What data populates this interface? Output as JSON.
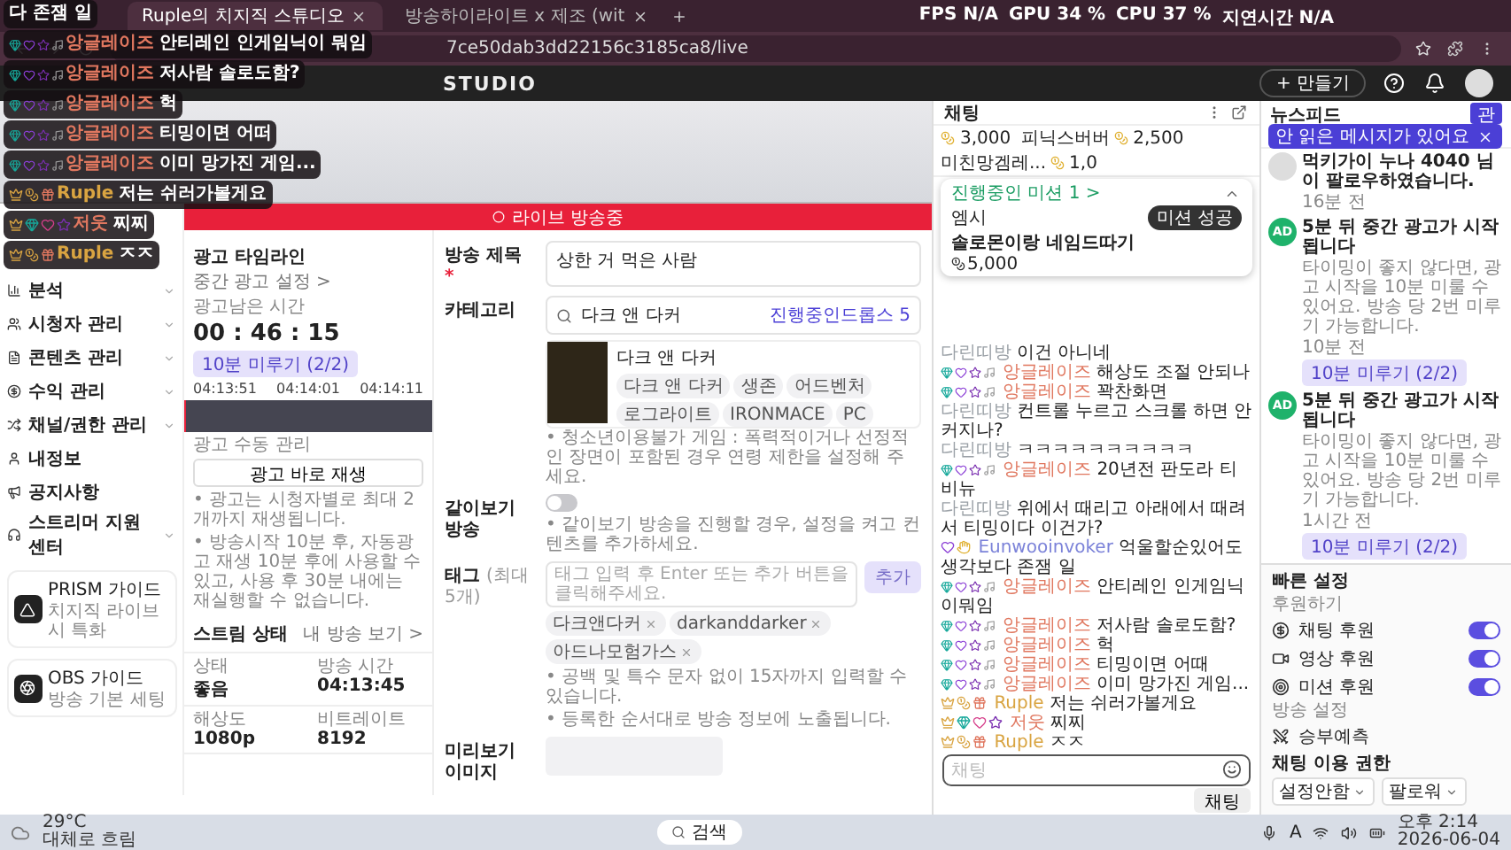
{
  "browser": {
    "tabs": [
      {
        "title": "Ruple의 치지직 스튜디오",
        "selected": true
      },
      {
        "title": "방송하이라이트 x 제조 (wit",
        "selected": false
      }
    ],
    "address": "7ce50dab3dd22156c3185ca8/live"
  },
  "stats": [
    {
      "label": "FPS",
      "value": "N/A"
    },
    {
      "label": "GPU",
      "value": "34 %"
    },
    {
      "label": "CPU",
      "value": "37 %"
    },
    {
      "label": "지연시간",
      "value": "N/A"
    }
  ],
  "studio_header": {
    "logo": "STUDIO",
    "create_button": "+ 만들기"
  },
  "overlay_chat": [
    {
      "kind": "text",
      "message": "다 존잼 일"
    },
    {
      "kind": "subscriber",
      "name": "앙글레이즈",
      "color": "#e0775f",
      "message": "안티레인 인게임닉이 뭐임"
    },
    {
      "kind": "subscriber",
      "name": "앙글레이즈",
      "color": "#e0775f",
      "message": "저사람 솔로도함?"
    },
    {
      "kind": "subscriber",
      "name": "앙글레이즈",
      "color": "#e0775f",
      "message": "헉"
    },
    {
      "kind": "subscriber",
      "name": "앙글레이즈",
      "color": "#e0775f",
      "message": "티밍이면 어떠"
    },
    {
      "kind": "subscriber",
      "name": "앙글레이즈",
      "color": "#e0775f",
      "message": "이미 망가진 게임..."
    },
    {
      "kind": "streamer",
      "name": "Ruple",
      "color": "#d9a441",
      "message": "저는 쉬러가볼게요"
    },
    {
      "kind": "member",
      "name": "저웃",
      "color": "#e0775f",
      "message": "찌찌"
    },
    {
      "kind": "streamer",
      "name": "Ruple",
      "color": "#d9a441",
      "message": "ㅈㅈ"
    }
  ],
  "live_banner": "라이브 방송중",
  "sidebar": {
    "items": [
      {
        "label": "분석",
        "expandable": true
      },
      {
        "label": "시청자 관리",
        "expandable": true
      },
      {
        "label": "콘텐츠 관리",
        "expandable": true
      },
      {
        "label": "수익 관리",
        "expandable": true
      },
      {
        "label": "채널/권한 관리",
        "expandable": true
      },
      {
        "label": "내정보",
        "expandable": false
      },
      {
        "label": "공지사항",
        "expandable": false
      },
      {
        "label": "스트리머 지원센터",
        "expandable": true
      }
    ],
    "guides": [
      {
        "kind": "prism",
        "title": "PRISM 가이드",
        "subtitle": "치지직 라이브시 특화"
      },
      {
        "kind": "obs",
        "title": "OBS 가이드",
        "subtitle": "방송 기본 세팅"
      }
    ]
  },
  "ad_timeline": {
    "title": "광고 타임라인",
    "settings_link": "중간 광고 설정 >",
    "remaining_label": "광고남은 시간",
    "remaining": "00 : 46 : 15",
    "delay_button": "10분 미루기 (2/2)",
    "ticks": [
      "04:13:51",
      "04:14:01",
      "04:14:11"
    ],
    "manual_label": "광고 수동 관리",
    "play_button": "광고 바로 재생",
    "notes": [
      "• 광고는 시청자별로 최대 2개까지 재생됩니다.",
      "• 방송시작 10분 후, 자동광고 재생 10분 후에 사용할 수 있고, 사용 후 30분 내에는 재실행할 수 없습니다."
    ]
  },
  "stream_status": {
    "title": "스트림 상태",
    "link": "내 방송 보기 >",
    "cells": [
      {
        "label": "상태",
        "value": "좋음"
      },
      {
        "label": "방송 시간",
        "value": "04:13:45"
      },
      {
        "label": "해상도",
        "value": "1080p"
      },
      {
        "label": "비트레이트",
        "value": "8192"
      }
    ]
  },
  "form": {
    "title_label": "방송 제목",
    "title_required": "*",
    "title_value": "상한 거 먹은 사람",
    "category_label": "카테고리",
    "category_value": "다크 앤 다커",
    "drops": "진행중인드롭스 5",
    "game": {
      "name": "다크 앤 다커",
      "tags": [
        "다크 앤 다커",
        "생존",
        "어드벤처",
        "로그라이트",
        "IRONMACE",
        "PC"
      ]
    },
    "category_note": "• 청소년이용불가 게임 : 폭력적이거나 선정적인 장면이 포함된 경우 연령 제한을 설정해 주세요.",
    "co_viewing": {
      "label": "같이보기 방송",
      "on": false,
      "note": "• 같이보기 방송을 진행할 경우, 설정을 켜고 컨텐츠를 추가하세요."
    },
    "tag_label": "태그",
    "tag_hint": "(최대 5개)",
    "tag_placeholder": "태그 입력 후 Enter 또는 추가 버튼을 클릭해주세요.",
    "tag_add": "추가",
    "tags": [
      "다크앤다커",
      "darkanddarker",
      "아드나모험가스"
    ],
    "tag_notes": [
      "• 공백 및 특수 문자 없이 15자까지 입력할 수 있습니다.",
      "• 등록한 순서대로 방송 정보에 노출됩니다."
    ],
    "preview_label": "미리보기 이미지"
  },
  "chat": {
    "title": "채팅",
    "ticker": [
      {
        "amount": "3,000"
      },
      {
        "name": "피닉스버버",
        "amount": "2,500"
      },
      {
        "name": "미친망겜레...",
        "amount": "1,0"
      }
    ],
    "mission": {
      "header": "진행중인 미션 1 >",
      "user": "엠시",
      "status": "미션 성공",
      "title": "솔로몬이랑 네임드따기",
      "amount": "5,000"
    },
    "messages": [
      {
        "kind": "viewer",
        "name": "다린띠방",
        "color": "#9aa0a6",
        "message": "이건 아니네"
      },
      {
        "kind": "subscriber",
        "name": "앙글레이즈",
        "color": "#e0775f",
        "message": "해상도 조절 안되나"
      },
      {
        "kind": "subscriber",
        "name": "앙글레이즈",
        "color": "#e0775f",
        "message": "꽉찬화면"
      },
      {
        "kind": "viewer",
        "name": "다린띠방",
        "color": "#9aa0a6",
        "message": "컨트롤 누르고 스크롤 하면 안커지나?"
      },
      {
        "kind": "viewer",
        "name": "다린띠방",
        "color": "#9aa0a6",
        "message": "ㅋㅋㅋㅋㅋㅋㅋㅋㅋㅋ"
      },
      {
        "kind": "subscriber",
        "name": "앙글레이즈",
        "color": "#e0775f",
        "message": "20년전 판도라 티비뉴"
      },
      {
        "kind": "viewer",
        "name": "다린띠방",
        "color": "#9aa0a6",
        "message": "위에서 때리고 아래에서 때려서 티밍이다 이건가?"
      },
      {
        "kind": "fan",
        "name": "Eunwooinvoker",
        "color": "#7c83d9",
        "message": "억울할순있어도 생각보다 존잼 일"
      },
      {
        "kind": "subscriber",
        "name": "앙글레이즈",
        "color": "#e0775f",
        "message": "안티레인 인게임닉이뭐임"
      },
      {
        "kind": "subscriber",
        "name": "앙글레이즈",
        "color": "#e0775f",
        "message": "저사람 솔로도함?"
      },
      {
        "kind": "subscriber",
        "name": "앙글레이즈",
        "color": "#e0775f",
        "message": "헉"
      },
      {
        "kind": "subscriber",
        "name": "앙글레이즈",
        "color": "#e0775f",
        "message": "티밍이면 어때"
      },
      {
        "kind": "subscriber",
        "name": "앙글레이즈",
        "color": "#e0775f",
        "message": "이미 망가진 게임..."
      },
      {
        "kind": "streamer",
        "name": "Ruple",
        "color": "#d9a441",
        "message": "저는 쉬러가볼게요"
      },
      {
        "kind": "member",
        "name": "저웃",
        "color": "#e0775f",
        "message": "찌찌"
      },
      {
        "kind": "streamer",
        "name": "Ruple",
        "color": "#d9a441",
        "message": "ㅈㅈ"
      }
    ],
    "input_placeholder": "채팅",
    "send_button": "채팅"
  },
  "newsfeed": {
    "title": "뉴스피드",
    "tooltip": "안 읽은 메시지가 있어요",
    "read_button": "관",
    "items": [
      {
        "kind": "follow",
        "title": "먹키가이 누나 4040 님이 팔로우하였습니다.",
        "time": "16분 전"
      },
      {
        "kind": "ad",
        "title": "5분 뒤 중간 광고가 시작됩니다",
        "body": "타이밍이 좋지 않다면, 광고 시작을 10분 미룰 수 있어요. 방송 당 2번 미루기 가능합니다.",
        "time": "10분 전",
        "button": "10분 미루기 (2/2)",
        "avatar": "AD"
      },
      {
        "kind": "ad",
        "title": "5분 뒤 중간 광고가 시작됩니다",
        "body": "타이밍이 좋지 않다면, 광고 시작을 10분 미룰 수 있어요. 방송 당 2번 미루기 가능합니다.",
        "time": "1시간 전",
        "button": "10분 미루기 (2/2)",
        "avatar": "AD"
      }
    ]
  },
  "quick_settings": {
    "title": "빠른 설정",
    "donation_label": "후원하기",
    "donations": [
      {
        "kind": "chat",
        "label": "채팅 후원",
        "on": true
      },
      {
        "kind": "video",
        "label": "영상 후원",
        "on": true
      },
      {
        "kind": "mission",
        "label": "미션 후원",
        "on": true
      }
    ],
    "broadcast_label": "방송 설정",
    "prediction": "승부예측",
    "chat_permission": "채팅 이용 권한",
    "selects": [
      "설정안함",
      "팔로워"
    ]
  },
  "taskbar": {
    "temperature": "29°C",
    "weather": "대체로 흐림",
    "search": "검색",
    "ime": "A",
    "time": "오후 2:14",
    "date": "2026-06-04"
  }
}
